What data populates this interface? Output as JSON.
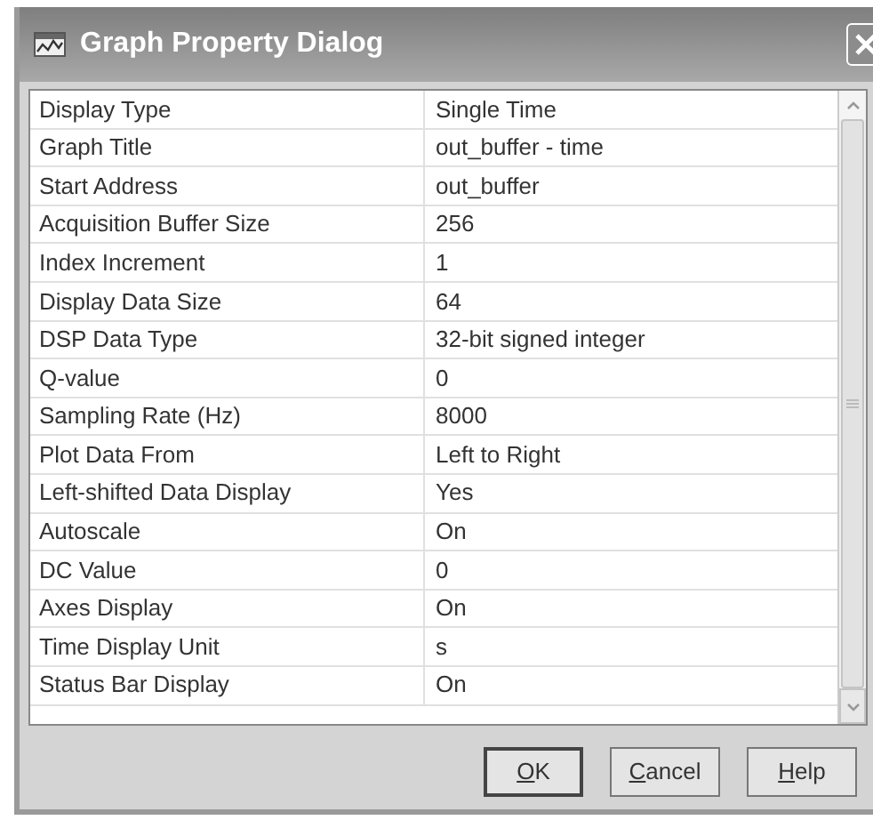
{
  "window": {
    "title": "Graph Property Dialog"
  },
  "properties": [
    {
      "label": "Display Type",
      "value": "Single Time"
    },
    {
      "label": "Graph Title",
      "value": "out_buffer - time"
    },
    {
      "label": "Start Address",
      "value": "out_buffer"
    },
    {
      "label": "Acquisition Buffer Size",
      "value": "256"
    },
    {
      "label": "Index Increment",
      "value": "1"
    },
    {
      "label": "Display Data Size",
      "value": "64"
    },
    {
      "label": "DSP Data Type",
      "value": "32-bit signed integer"
    },
    {
      "label": "Q-value",
      "value": "0"
    },
    {
      "label": "Sampling Rate (Hz)",
      "value": "8000"
    },
    {
      "label": "Plot Data From",
      "value": "Left to Right"
    },
    {
      "label": "Left-shifted Data Display",
      "value": "Yes"
    },
    {
      "label": "Autoscale",
      "value": "On"
    },
    {
      "label": "DC Value",
      "value": "0"
    },
    {
      "label": "Axes Display",
      "value": "On"
    },
    {
      "label": "Time Display Unit",
      "value": "s"
    },
    {
      "label": "Status Bar Display",
      "value": "On"
    }
  ],
  "buttons": [
    {
      "label": "OK",
      "access_key_shown": true,
      "default": true
    },
    {
      "label": "Cancel",
      "access_key_shown": true,
      "default": false
    },
    {
      "label": "Help",
      "access_key_shown": true,
      "default": false
    }
  ]
}
